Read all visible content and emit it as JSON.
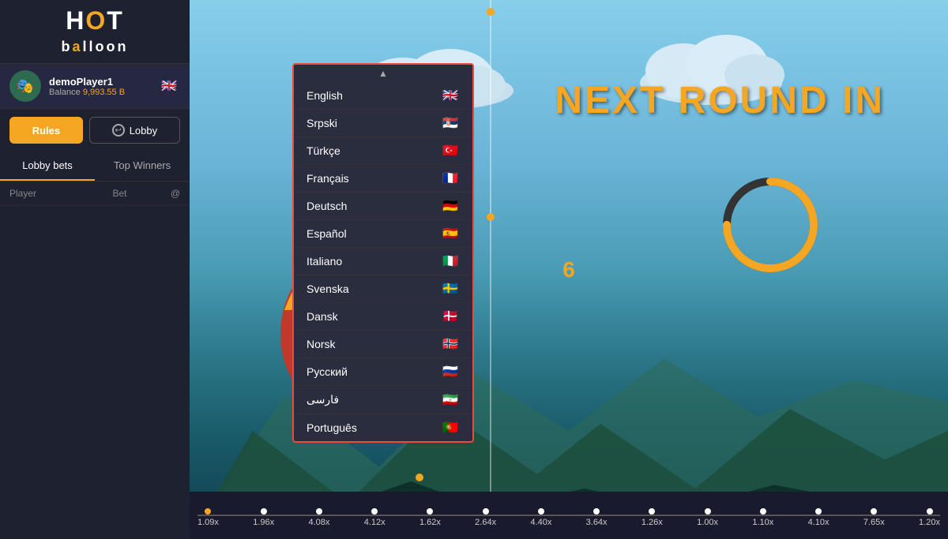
{
  "app": {
    "title": "HOT Balloon"
  },
  "logo": {
    "line1": "HOT",
    "line2": "balloon"
  },
  "user": {
    "name": "demoPlayer1",
    "balance_label": "Balance",
    "balance": "9,993.55 B",
    "avatar_emoji": "🎭"
  },
  "buttons": {
    "rules": "Rules",
    "lobby": "Lobby"
  },
  "tabs": {
    "lobby_bets": "Lobby bets",
    "top_winners": "Top Winners"
  },
  "table": {
    "columns": {
      "player": "Player",
      "bet": "Bet",
      "at": "@"
    }
  },
  "game": {
    "next_round_text": "NEXT ROUND IN",
    "countdown": "6"
  },
  "timeline": {
    "items": [
      {
        "label": "1.09x",
        "dot": "orange"
      },
      {
        "label": "1.96x",
        "dot": "white"
      },
      {
        "label": "4.08x",
        "dot": "white"
      },
      {
        "label": "4.12x",
        "dot": "white"
      },
      {
        "label": "1.62x",
        "dot": "white"
      },
      {
        "label": "2.64x",
        "dot": "white"
      },
      {
        "label": "4.40x",
        "dot": "white"
      },
      {
        "label": "3.64x",
        "dot": "white"
      },
      {
        "label": "1.26x",
        "dot": "white"
      },
      {
        "label": "1.00x",
        "dot": "white"
      },
      {
        "label": "1.10x",
        "dot": "white"
      },
      {
        "label": "4.10x",
        "dot": "white"
      },
      {
        "label": "7.65x",
        "dot": "white"
      },
      {
        "label": "1.20x",
        "dot": "white"
      }
    ]
  },
  "languages": [
    {
      "name": "English",
      "flag": "🇬🇧"
    },
    {
      "name": "Srpski",
      "flag": "🇷🇸"
    },
    {
      "name": "Türkçe",
      "flag": "🇹🇷"
    },
    {
      "name": "Français",
      "flag": "🇫🇷"
    },
    {
      "name": "Deutsch",
      "flag": "🇩🇪"
    },
    {
      "name": "Español",
      "flag": "🇪🇸"
    },
    {
      "name": "Italiano",
      "flag": "🇮🇹"
    },
    {
      "name": "Svenska",
      "flag": "🇸🇪"
    },
    {
      "name": "Dansk",
      "flag": "🇩🇰"
    },
    {
      "name": "Norsk",
      "flag": "🇳🇴"
    },
    {
      "name": "Русский",
      "flag": "🇷🇺"
    },
    {
      "name": "فارسی",
      "flag": "🇮🇷"
    },
    {
      "name": "Português",
      "flag": "🇵🇹"
    }
  ]
}
